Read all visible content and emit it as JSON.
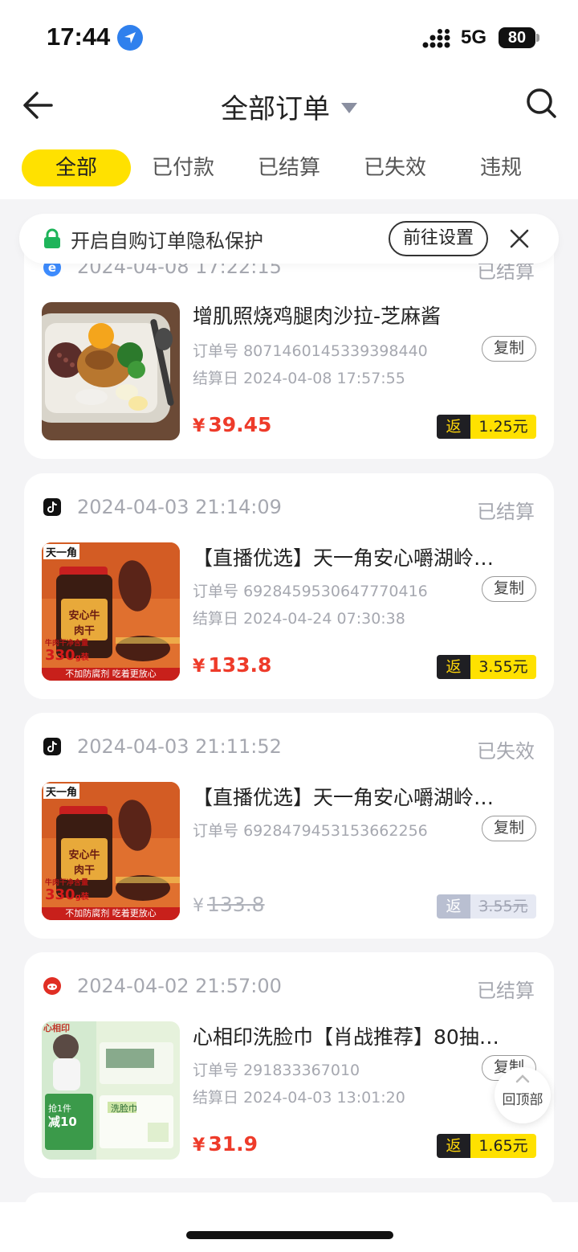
{
  "status_bar": {
    "time": "17:44",
    "network": "5G",
    "battery": "80"
  },
  "nav": {
    "title": "全部订单"
  },
  "tabs": [
    {
      "label": "全部",
      "active": true
    },
    {
      "label": "已付款",
      "active": false
    },
    {
      "label": "已结算",
      "active": false
    },
    {
      "label": "已失效",
      "active": false
    },
    {
      "label": "违规",
      "active": false
    }
  ],
  "notice": {
    "text": "开启自购订单隐私保护",
    "button": "前往设置"
  },
  "labels": {
    "order_no": "订单号",
    "settle_date": "结算日",
    "copy": "复制",
    "rebate": "返",
    "yen": "¥"
  },
  "orders": [
    {
      "date": "2024-04-08 17:22:15",
      "status": "已结算",
      "platform": "e",
      "title": "增肌照烧鸡腿肉沙拉-芝麻酱",
      "order_no": "8071460145339398440",
      "settle_date": "2024-04-08 17:57:55",
      "price": "39.45",
      "rebate": "1.25元"
    },
    {
      "date": "2024-04-03 21:14:09",
      "status": "已结算",
      "platform": "tiktok",
      "title": "【直播优选】天一角安心嚼湖岭…",
      "order_no": "6928459530647770416",
      "settle_date": "2024-04-24 07:30:38",
      "price": "133.8",
      "rebate": "3.55元",
      "thumb": {
        "brand": "天一角",
        "jar": "安心牛肉干",
        "weight": "330",
        "unit": "g装",
        "weight_label": "牛肉干净含量",
        "banner": "不加防腐剂 吃着更放心"
      }
    },
    {
      "date": "2024-04-03 21:11:52",
      "status": "已失效",
      "platform": "tiktok",
      "title": "【直播优选】天一角安心嚼湖岭…",
      "order_no": "6928479453153662256",
      "price": "133.8",
      "rebate": "3.55元",
      "thumb": {
        "brand": "天一角",
        "jar": "安心牛肉干",
        "weight": "330",
        "unit": "g装",
        "weight_label": "牛肉干净含量",
        "banner": "不加防腐剂 吃着更放心"
      }
    },
    {
      "date": "2024-04-02 21:57:00",
      "status": "已结算",
      "platform": "pinduoduo",
      "title": "心相印洗脸巾【肖战推荐】80抽…",
      "order_no": "291833367010",
      "settle_date": "2024-04-03 13:01:20",
      "price": "31.9",
      "rebate": "1.65元",
      "thumb": {
        "brand": "心相印",
        "promo": "抢1件",
        "discount": "减10",
        "pack": "洗脸巾"
      }
    }
  ],
  "to_top": "回顶部",
  "colors": {
    "accent": "#ffe100",
    "price": "#ee3b2a",
    "muted": "#a6a8b0"
  }
}
